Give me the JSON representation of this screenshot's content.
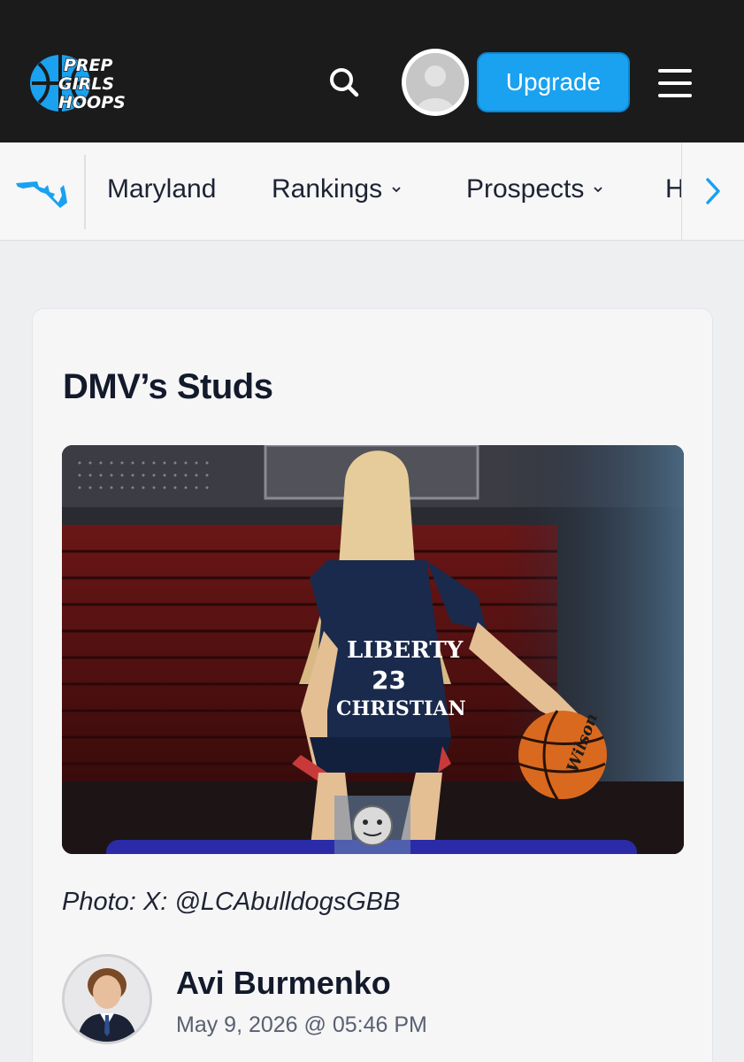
{
  "header": {
    "logo_text": [
      "PREP",
      "GIRLS",
      "HOOPS"
    ],
    "logo_icon": "basketball-logo",
    "search_icon": "search-icon",
    "avatar_icon": "user-avatar-placeholder",
    "upgrade_label": "Upgrade",
    "menu_icon": "hamburger-menu-icon"
  },
  "subnav": {
    "state_icon": "maryland-state-icon",
    "items": [
      {
        "label": "Maryland",
        "has_dropdown": false
      },
      {
        "label": "Rankings",
        "has_dropdown": true
      },
      {
        "label": "Prospects",
        "has_dropdown": true
      }
    ],
    "cut_item_label": "H",
    "next_icon": "chevron-right-icon"
  },
  "article": {
    "title": "DMV’s Studs",
    "hero_image": "player photo — Liberty Christian #23 dribbling basketball",
    "photo_credit": "Photo: X: @LCAbulldogsGBB",
    "author": {
      "name": "Avi Burmenko",
      "date": "May 9, 2026 @ 05:46 PM"
    }
  },
  "colors": {
    "header_bg": "#1b1b1b",
    "accent": "#1aa1f0",
    "page_bg": "#eeeff1",
    "card_bg": "#f6f6f7"
  }
}
